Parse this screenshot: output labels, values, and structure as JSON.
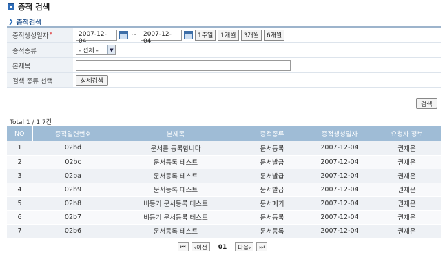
{
  "page": {
    "title": "증적 검색"
  },
  "section": {
    "title": "증적검색"
  },
  "form": {
    "date_label": "증적생성일자",
    "required_mark": "*",
    "date_from": "2007-12-04",
    "tilde": "~",
    "date_to": "2007-12-04",
    "period_buttons": [
      "1주일",
      "1개월",
      "3개월",
      "6개월"
    ],
    "type_label": "증적종류",
    "type_selected": "- 전체 -",
    "subject_label": "본제목",
    "subject_value": "",
    "search_type_label": "검색 종류 선택",
    "detail_search_button": "상세검색"
  },
  "search_button": "검색",
  "total": "Total 1 / 1  7건",
  "table": {
    "headers": [
      "NO",
      "증적일련번호",
      "본제목",
      "증적종류",
      "증적생성일자",
      "요청자 정보"
    ],
    "rows": [
      [
        "1",
        "02bd",
        "문서를 등록합니다",
        "문서등록",
        "2007-12-04",
        "권재은"
      ],
      [
        "2",
        "02bc",
        "문서등록 테스트",
        "문서발급",
        "2007-12-04",
        "권재은"
      ],
      [
        "3",
        "02ba",
        "문서등록 테스트",
        "문서발급",
        "2007-12-04",
        "권재은"
      ],
      [
        "4",
        "02b9",
        "문서등록 테스트",
        "문서발급",
        "2007-12-04",
        "권재은"
      ],
      [
        "5",
        "02b8",
        "비등기 문서등록 테스트",
        "문서폐기",
        "2007-12-04",
        "권재은"
      ],
      [
        "6",
        "02b7",
        "비등기 문서등록 테스트",
        "문서등록",
        "2007-12-04",
        "권재은"
      ],
      [
        "7",
        "02b6",
        "문서등록 테스트",
        "문서등록",
        "2007-12-04",
        "권재은"
      ]
    ]
  },
  "pager": {
    "first": "⏮",
    "prev": "‹이전",
    "current": "01",
    "next": "다음›",
    "last": "⏭"
  }
}
